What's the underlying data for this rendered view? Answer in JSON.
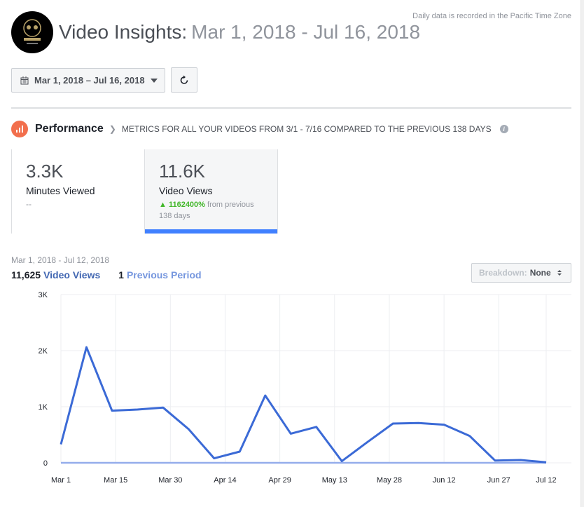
{
  "header": {
    "title": "Video Insights:",
    "date_range": "Mar 1, 2018 - Jul 16, 2018",
    "timezone_note": "Daily data is recorded in the Pacific Time Zone",
    "logo_text": "CALAVERA"
  },
  "toolbar": {
    "date_picker_label": "Mar 1, 2018 – Jul 16, 2018"
  },
  "performance": {
    "title": "Performance",
    "subtitle": "METRICS FOR ALL YOUR VIDEOS FROM 3/1 - 7/16 COMPARED TO THE PREVIOUS 138 DAYS",
    "info": "i"
  },
  "metrics": [
    {
      "value": "3.3K",
      "label": "Minutes Viewed",
      "change": "--"
    },
    {
      "value": "11.6K",
      "label": "Video Views",
      "change_pct": "1162400%",
      "change_suffix": "from previous",
      "change_period": "138 days",
      "selected": true
    }
  ],
  "chart_header": {
    "range": "Mar 1, 2018 - Jul 12, 2018",
    "total": "11,625",
    "series1": "Video Views",
    "prev_total": "1",
    "series2": "Previous Period"
  },
  "breakdown": {
    "label": "Breakdown:",
    "value": "None"
  },
  "colors": {
    "accent": "#4080ff",
    "series": "#3b6ad6",
    "previous": "#95adeb",
    "positive": "#42b72a",
    "perf_icon": "#f26f4d"
  },
  "chart_data": {
    "type": "line",
    "x": [
      "Mar 1",
      "Mar 8",
      "Mar 15",
      "Mar 22",
      "Mar 29",
      "Apr 5",
      "Apr 12",
      "Apr 19",
      "Apr 26",
      "May 3",
      "May 10",
      "May 17",
      "May 24",
      "May 31",
      "Jun 7",
      "Jun 14",
      "Jun 21",
      "Jun 28",
      "Jul 5",
      "Jul 12"
    ],
    "series": [
      {
        "name": "Video Views",
        "values": [
          330,
          2060,
          930,
          950,
          985,
          600,
          80,
          200,
          1200,
          520,
          640,
          30,
          370,
          700,
          710,
          680,
          480,
          40,
          50,
          10
        ]
      },
      {
        "name": "Previous Period",
        "values": [
          0,
          0,
          0,
          0,
          0,
          0,
          0,
          0,
          0,
          0,
          0,
          0,
          0,
          0,
          0,
          0,
          0,
          0,
          0,
          1
        ]
      }
    ],
    "x_ticks": [
      "Mar 1",
      "Mar 15",
      "Mar 30",
      "Apr 14",
      "Apr 29",
      "May 13",
      "May 28",
      "Jun 12",
      "Jun 27",
      "Jul 12"
    ],
    "y_ticks": [
      "0",
      "1K",
      "2K",
      "3K"
    ],
    "ylim": [
      0,
      3000
    ],
    "grid": true
  }
}
